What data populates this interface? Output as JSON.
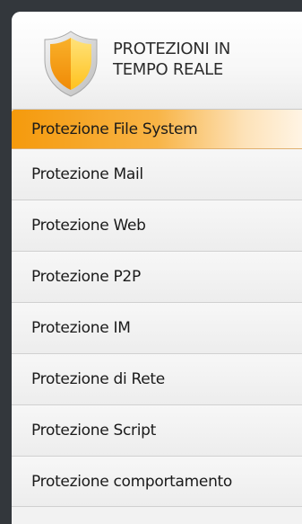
{
  "header": {
    "title": "PROTEZIONI IN\nTEMPO REALE",
    "icon": "shield-icon",
    "colors": {
      "shield_left": "#f7a21b",
      "shield_right": "#ffd24a",
      "shield_rim": "#c9c9c9"
    }
  },
  "menu": {
    "active_color": "#f59a0c",
    "items": [
      {
        "label": "Protezione File System"
      },
      {
        "label": "Protezione Mail"
      },
      {
        "label": "Protezione Web"
      },
      {
        "label": "Protezione P2P"
      },
      {
        "label": "Protezione IM"
      },
      {
        "label": "Protezione di Rete"
      },
      {
        "label": "Protezione Script"
      },
      {
        "label": "Protezione comportamento"
      }
    ]
  }
}
